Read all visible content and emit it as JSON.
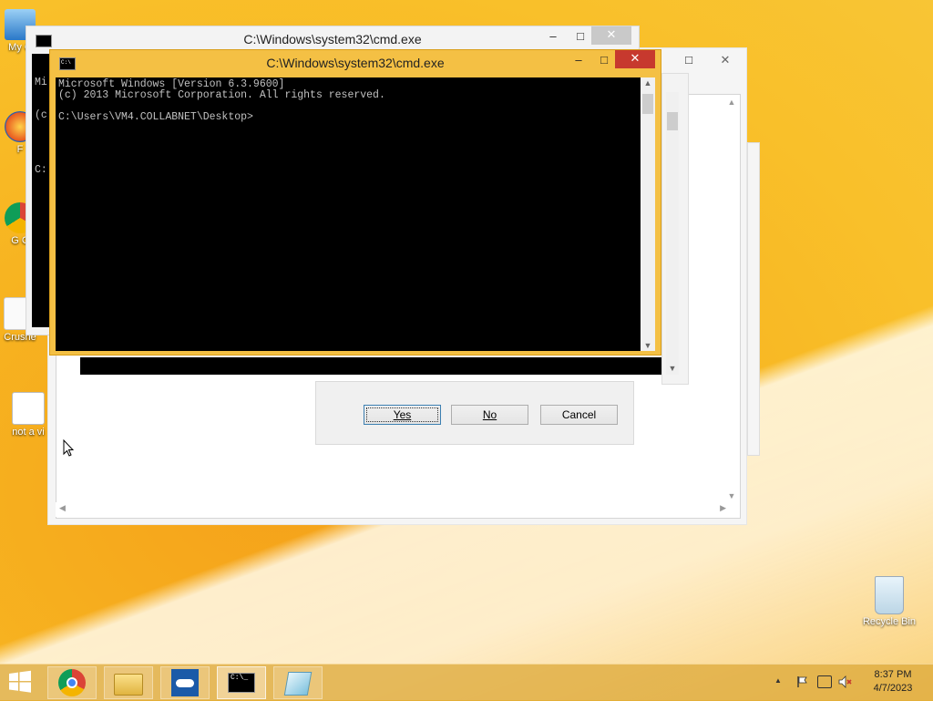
{
  "desktop": {
    "icons": [
      {
        "label": "My C",
        "name": "my-computer-icon"
      },
      {
        "label": "F",
        "name": "firefox-icon"
      },
      {
        "label": "G C",
        "name": "google-chrome-icon"
      },
      {
        "label": "Crushe",
        "name": "crusher-icon"
      },
      {
        "label": "not a vi",
        "name": "settings-shortcut-icon"
      },
      {
        "label": "Recycle Bin",
        "name": "recycle-bin-icon"
      }
    ]
  },
  "back_cmd": {
    "title": "C:\\Windows\\system32\\cmd.exe",
    "console_lines": [
      "Mi",
      "(c",
      "",
      "C:"
    ]
  },
  "front_cmd": {
    "title": "C:\\Windows\\system32\\cmd.exe",
    "console_text": "Microsoft Windows [Version 6.3.9600]\n(c) 2013 Microsoft Corporation. All rights reserved.\n\nC:\\Users\\VM4.COLLABNET\\Desktop>",
    "minimize": "–",
    "maximize": "□",
    "close": "✕"
  },
  "dialog": {
    "buttons": {
      "yes": "Yes",
      "no": "No",
      "cancel": "Cancel"
    }
  },
  "taskbar": {
    "time": "8:37 PM",
    "date": "4/7/2023",
    "tray_up": "▲"
  },
  "colors": {
    "accent_frame": "#f4c044",
    "close_red": "#c7392e"
  }
}
